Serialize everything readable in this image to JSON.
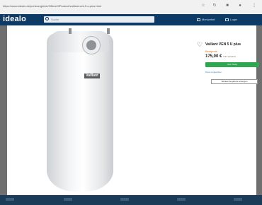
{
  "browser": {
    "url": "https://www.idealo.de/preisvergleich/OffersOfProduct/vaillant-vek-5-u-plus.html"
  },
  "header": {
    "logo": "idealo",
    "search_placeholder": "Suche",
    "nav": [
      "Merkzettel",
      "Login"
    ]
  },
  "product": {
    "brand_plate": "Vaillant",
    "title": "Vaillant VEN 5 U plus",
    "price_label": "Bestpreis",
    "price": "175,00 €",
    "price_note": "inkl. Versand",
    "cta": "Zum Shop",
    "shop_link": "Preis vergleichen",
    "secondary_button": "Weitere Angebote anzeigen"
  },
  "colors": {
    "header": "#0d3b66",
    "cta": "#2fa84f",
    "accent": "#e0781a"
  }
}
